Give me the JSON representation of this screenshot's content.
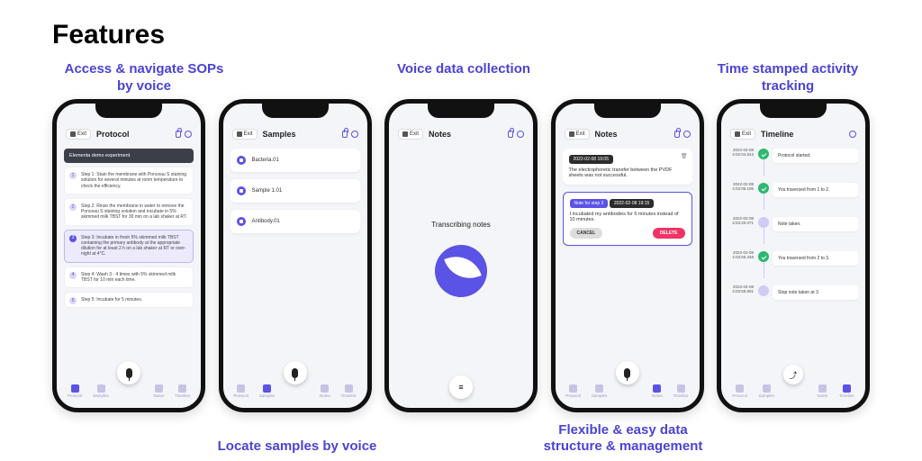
{
  "page_title": "Features",
  "captions": {
    "top_left": "Access & navigate SOPs by voice",
    "top_mid": "Voice data collection",
    "top_right": "Time stamped activity tracking",
    "bottom_1": "Locate samples by voice",
    "bottom_2": "Flexible & easy data structure & management"
  },
  "nav_tabs": [
    "Protocol",
    "Samples",
    "Mic",
    "Notes",
    "Timeline"
  ],
  "exit_label": "Exit",
  "phone1": {
    "title": "Protocol",
    "banner": "Elementa demo experiment",
    "steps": [
      "Step 1: Stain the membrane with Ponceau S staining solution for several minutes at room temperature to check the efficiency.",
      "Step 2: Rinse the membrane in water to remove the Ponceau S staining solution and incubate in 5% skimmed milk TBST for 30 min on a lab shaker at RT.",
      "Step 3: Incubate in fresh 5% skimmed milk TBST containing the primary antibody at the appropriate dilution for at least 2 h on a lab shaker at RT or over-night at 4°C.",
      "Step 4: Wash 3 - 4 times with 5% skimmed milk TBST for 10 min each time.",
      "Step 5: Incubate for 5 minutes."
    ],
    "active_step": 2
  },
  "phone2": {
    "title": "Samples",
    "items": [
      "Bacteria.01",
      "Sample 1.01",
      "Antibody.01"
    ]
  },
  "phone3": {
    "title": "Notes",
    "transcribing": "Transcribing notes"
  },
  "phone4": {
    "title": "Notes",
    "note1": {
      "ts": "2022-02-08 19:05",
      "text": "The electrophoretic transfer between the PVDF sheets was not successful."
    },
    "note2": {
      "chip": "Note for step 3",
      "ts": "2022-02-08 19:15",
      "text": "I incubated my antibodies for 5 minutes instead of 10 minutes."
    },
    "cancel": "CANCEL",
    "delete": "DELETE"
  },
  "phone5": {
    "title": "Timeline",
    "rows": [
      {
        "t": "2022-02-08 4:02:04.543",
        "kind": "g",
        "text": "Protocol started."
      },
      {
        "t": "2022-02-08 4:03:06.195",
        "kind": "g",
        "text": "You traversed from 1 to 2."
      },
      {
        "t": "2022-02-08 4:03:20.071",
        "kind": "p",
        "text": "Note taken."
      },
      {
        "t": "2022-02-08 4:03:56.348",
        "kind": "g",
        "text": "You traversed from 2 to 3."
      },
      {
        "t": "2022-02-08 4:03:58.891",
        "kind": "p",
        "text": "Stop note taken at 3."
      }
    ]
  }
}
